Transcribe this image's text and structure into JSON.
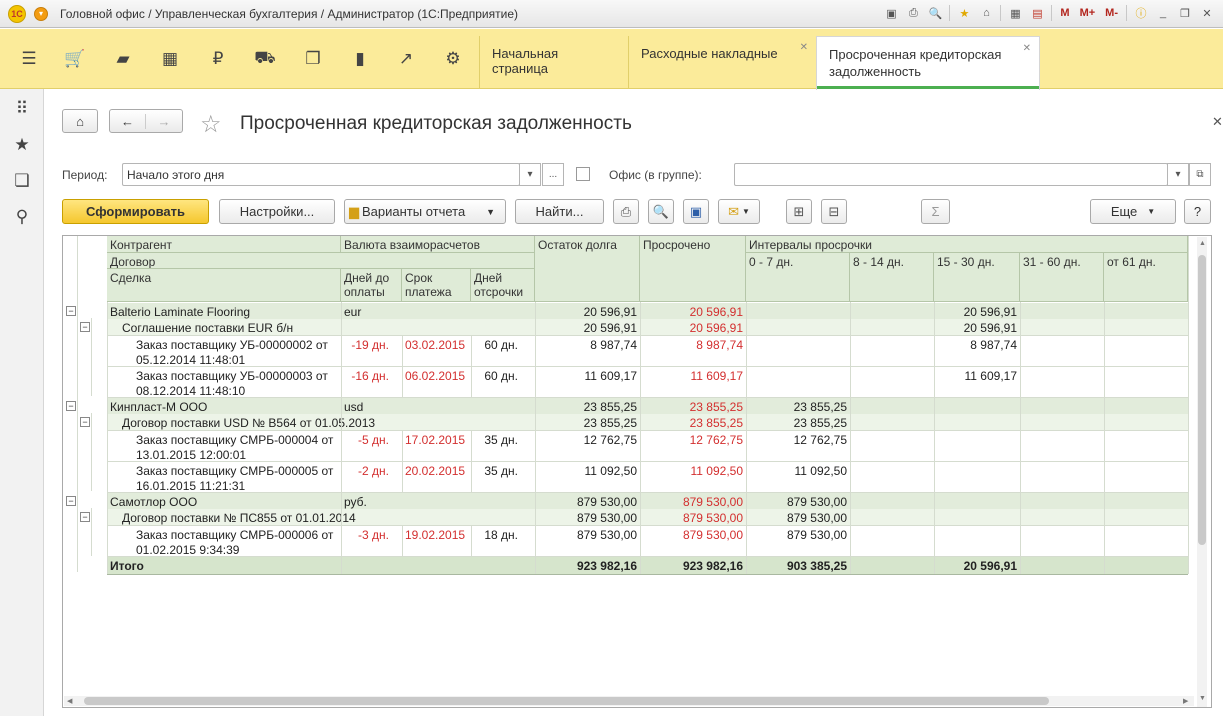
{
  "window": {
    "title": "Головной офис / Управленческая бухгалтерия / Администратор  (1С:Предприятие)",
    "logo": "1С",
    "tools_m": [
      "M",
      "M+",
      "M-"
    ]
  },
  "tabs": [
    {
      "label": "Начальная страница"
    },
    {
      "label": "Расходные накладные"
    },
    {
      "label": "Просроченная кредиторская задолженность",
      "line1": "Просроченная кредиторская",
      "line2": "задолженность"
    }
  ],
  "form": {
    "title": "Просроченная кредиторская задолженность",
    "period_label": "Период:",
    "period_value": "Начало этого дня",
    "office_label": "Офис (в группе):",
    "office_value": "",
    "select_dots": "..."
  },
  "toolbar": {
    "generate": "Сформировать",
    "settings": "Настройки...",
    "variants": "Варианты отчета",
    "find": "Найти...",
    "more": "Еще",
    "help": "?"
  },
  "report": {
    "headers": {
      "counterparty": "Контрагент",
      "contract": "Договор",
      "deal": "Сделка",
      "currency": "Валюта взаиморасчетов",
      "days_to_pay_1": "Дней до",
      "days_to_pay_2": "оплаты",
      "due_1": "Срок",
      "due_2": "платежа",
      "delay_1": "Дней",
      "delay_2": "отсрочки",
      "balance": "Остаток долга",
      "overdue": "Просрочено",
      "intervals": "Интервалы просрочки",
      "i1": "0 - 7 дн.",
      "i2": "8 - 14 дн.",
      "i3": "15 - 30 дн.",
      "i4": "31 - 60 дн.",
      "i5": "от 61 дн."
    },
    "rows": [
      {
        "name": "Balterio Laminate Flooring",
        "currency": "eur",
        "balance": "20 596,91",
        "overdue": "20 596,91",
        "i1": "",
        "i3": "20 596,91"
      },
      {
        "name": "Соглашение поставки EUR б/н",
        "balance": "20 596,91",
        "overdue": "20 596,91",
        "i1": "",
        "i3": "20 596,91"
      },
      {
        "name1": "Заказ поставщику УБ-00000002 от",
        "name2": "05.12.2014 11:48:01",
        "days": "-19 дн.",
        "due": "03.02.2015",
        "delay": "60 дн.",
        "balance": "8 987,74",
        "overdue": "8 987,74",
        "i1": "",
        "i3": "8 987,74"
      },
      {
        "name1": "Заказ поставщику УБ-00000003 от",
        "name2": "08.12.2014 11:48:10",
        "days": "-16 дн.",
        "due": "06.02.2015",
        "delay": "60 дн.",
        "balance": "11 609,17",
        "overdue": "11 609,17",
        "i1": "",
        "i3": "11 609,17"
      },
      {
        "name": "Кинпласт-М ООО",
        "currency": "usd",
        "balance": "23 855,25",
        "overdue": "23 855,25",
        "i1": "23 855,25",
        "i3": ""
      },
      {
        "name": "Договор поставки USD № В564 от 01.05.2013",
        "balance": "23 855,25",
        "overdue": "23 855,25",
        "i1": "23 855,25",
        "i3": ""
      },
      {
        "name1": "Заказ поставщику СМРБ-000004 от",
        "name2": "13.01.2015 12:00:01",
        "days": "-5 дн.",
        "due": "17.02.2015",
        "delay": "35 дн.",
        "balance": "12 762,75",
        "overdue": "12 762,75",
        "i1": "12 762,75",
        "i3": ""
      },
      {
        "name1": "Заказ поставщику СМРБ-000005 от",
        "name2": "16.01.2015 11:21:31",
        "days": "-2 дн.",
        "due": "20.02.2015",
        "delay": "35 дн.",
        "balance": "11 092,50",
        "overdue": "11 092,50",
        "i1": "11 092,50",
        "i3": ""
      },
      {
        "name": "Самотлор ООО",
        "currency": "руб.",
        "balance": "879 530,00",
        "overdue": "879 530,00",
        "i1": "879 530,00",
        "i3": ""
      },
      {
        "name": "Договор поставки № ПС855 от 01.01.2014",
        "balance": "879 530,00",
        "overdue": "879 530,00",
        "i1": "879 530,00",
        "i3": ""
      },
      {
        "name1": "Заказ поставщику СМРБ-000006 от",
        "name2": "01.02.2015 9:34:39",
        "days": "-3 дн.",
        "due": "19.02.2015",
        "delay": "18 дн.",
        "balance": "879 530,00",
        "overdue": "879 530,00",
        "i1": "879 530,00",
        "i3": ""
      }
    ],
    "total": {
      "label": "Итого",
      "balance": "923 982,16",
      "overdue": "923 982,16",
      "i1": "903 385,25",
      "i3": "20 596,91"
    }
  }
}
